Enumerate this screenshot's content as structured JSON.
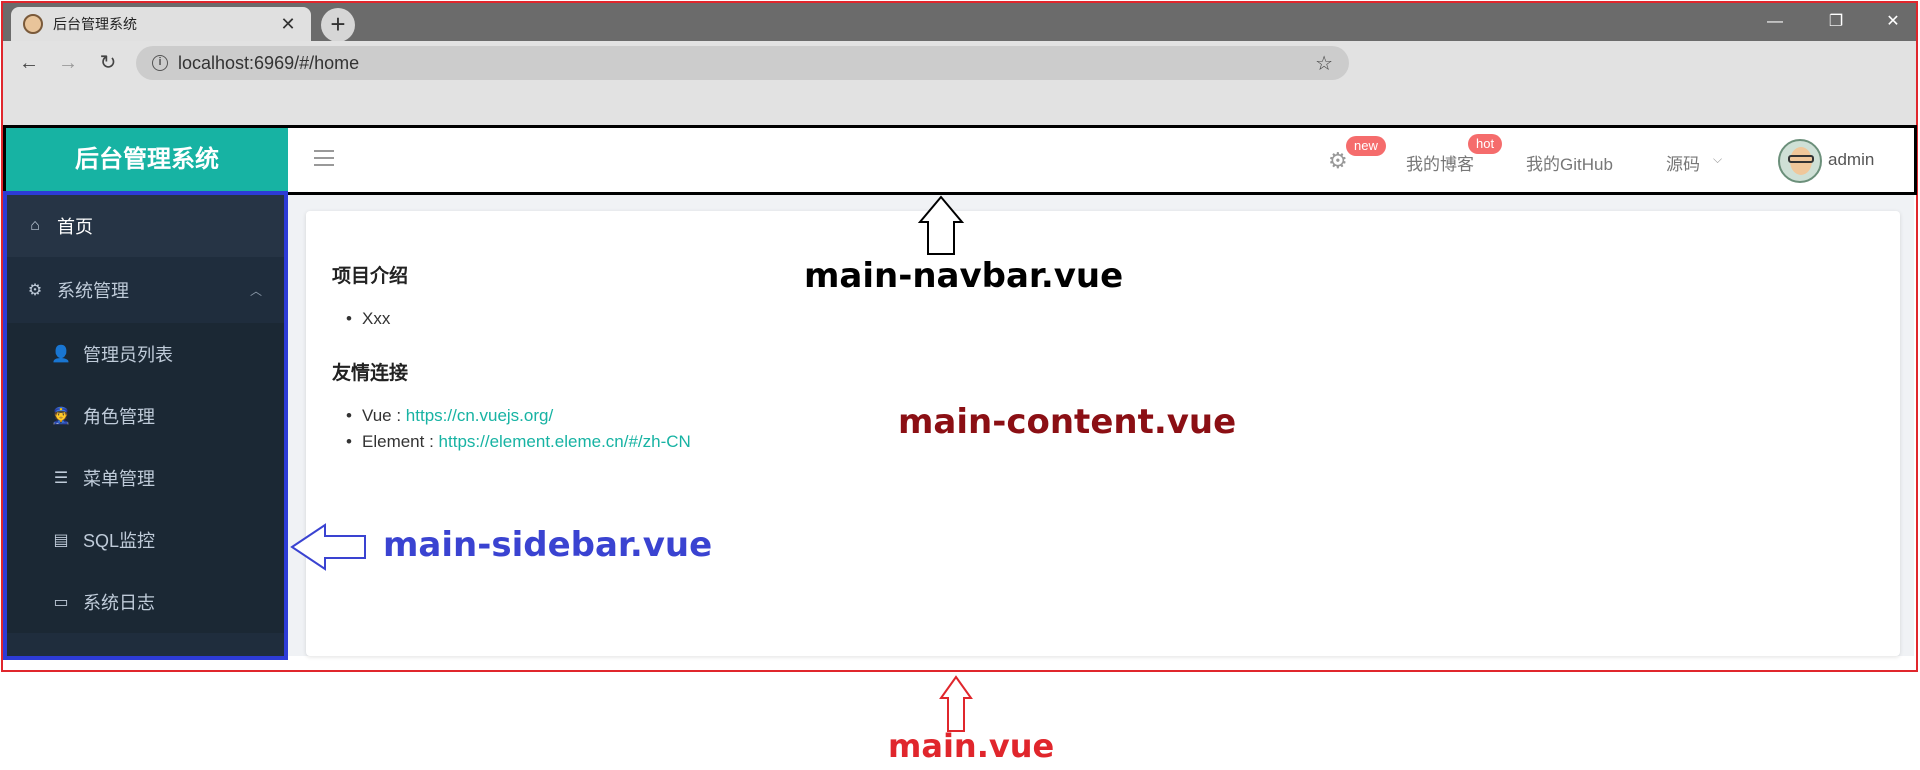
{
  "browser": {
    "tab_title": "后台管理系统",
    "new_tab": "+",
    "close": "✕",
    "url": "localhost:6969/#/home",
    "controls": {
      "minimize": "—",
      "restore": "❐",
      "close": "✕"
    },
    "back": "←",
    "forward": "→",
    "reload": "↻",
    "bookmark": "☆",
    "info": "i"
  },
  "app": {
    "brand": "后台管理系统",
    "navbar": {
      "settings_badge": "new",
      "blog": "我的博客",
      "blog_badge": "hot",
      "github": "我的GitHub",
      "source": "源码",
      "source_caret": "⌵",
      "user": "admin"
    },
    "sidebar": {
      "items": [
        {
          "label": "首页",
          "icon": "home-icon",
          "glyph": "⌂"
        },
        {
          "label": "系统管理",
          "icon": "gear-icon",
          "glyph": "⚙",
          "caret": "︿"
        },
        {
          "label": "管理员列表",
          "icon": "user-icon",
          "glyph": "👤"
        },
        {
          "label": "角色管理",
          "icon": "role-icon",
          "glyph": "👮"
        },
        {
          "label": "菜单管理",
          "icon": "list-icon",
          "glyph": "☰"
        },
        {
          "label": "SQL监控",
          "icon": "monitor-icon",
          "glyph": "▤"
        },
        {
          "label": "系统日志",
          "icon": "log-icon",
          "glyph": "▭"
        }
      ]
    },
    "content": {
      "intro_title": "项目介绍",
      "intro_item": "Xxx",
      "links_title": "友情连接",
      "links": [
        {
          "name": "Vue : ",
          "url": "https://cn.vuejs.org/"
        },
        {
          "name": "Element : ",
          "url": "https://element.eleme.cn/#/zh-CN"
        }
      ]
    }
  },
  "annotations": {
    "navbar": "main-navbar.vue",
    "content": "main-content.vue",
    "sidebar": "main-sidebar.vue",
    "main": "main.vue",
    "colors": {
      "navbar": "#000000",
      "content": "#8b0f14",
      "sidebar": "#3a43d1",
      "main": "#e0262c"
    }
  }
}
